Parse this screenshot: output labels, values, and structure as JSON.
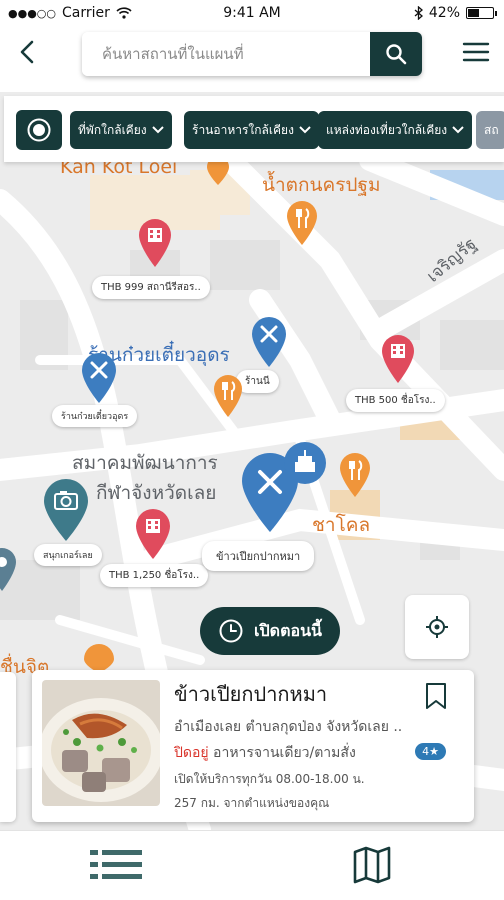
{
  "status_bar": {
    "carrier": "Carrier",
    "time": "9:41 AM",
    "battery": "42%"
  },
  "search": {
    "placeholder": "ค้นหาสถานที่ในแผนที่"
  },
  "filters": [
    {
      "label": "ที่พักใกล้เคียง"
    },
    {
      "label": "ร้านอาหารใกล้เคียง"
    },
    {
      "label": "แหล่งท่องเที่ยวใกล้เคียง"
    },
    {
      "label": "สถ"
    }
  ],
  "map_labels": {
    "kan_kot_loei": "Kan Kot Loei",
    "nam_tok": "น้ำตกนครปฐม",
    "charoen_rat": "เจริญรัฐ",
    "noodle_shop": "ร้านก๋วยเตี๋ยวอุดร",
    "sports_assoc_1": "สมาคมพัฒนาการ",
    "sports_assoc_2": "กีฬาจังหวัดเลย",
    "shacole": "ชาโคล",
    "bottom_left": "ชื่นจิต"
  },
  "map_tags": {
    "hotel_999": "THB 999  สถานีรีสอร..",
    "hotel_500": "THB 500  ชื่อโรง..",
    "hotel_1250": "THB 1,250  ชื่อโรง..",
    "food_small": "ร้านนี",
    "food_left": "ร้านก๋วยเตี๋ยวอุดร",
    "camera": "สนุกเกอร์เลย",
    "khao_piak": "ข้าวเปียกปากหมา"
  },
  "open_now": {
    "label": "เปิดตอนนี้"
  },
  "card": {
    "title": "ข้าวเปียกปากหมา",
    "address": "อำเมืองเลย ตำบลกุดป่อง จังหวัดเลย ..",
    "status": "ปิดอยู่",
    "category": "อาหารจานเดียว/ตามสั่ง",
    "rating": "4★",
    "hours": "เปิดให้บริการทุกวัน  08.00-18.00 น.",
    "distance": "257 กม. จากตำแหน่งของคุณ"
  },
  "colors": {
    "primary": "#173a3a",
    "map_bg": "#ececec",
    "road": "#ffffff",
    "pin_red": "#e04b5d",
    "pin_blue": "#3d7dc0",
    "pin_orange": "#f0953a",
    "pin_teal": "#3e7a8a",
    "status_closed": "#d9342b",
    "rating_bg": "#2e7ab5"
  }
}
